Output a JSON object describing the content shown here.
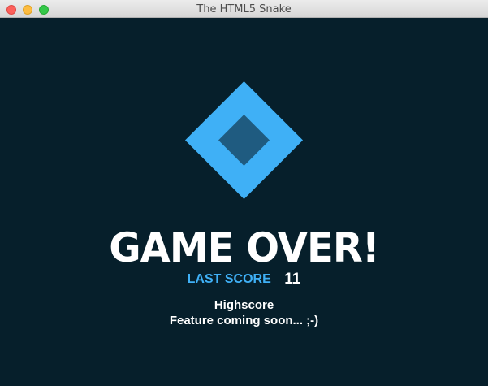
{
  "window": {
    "title": "The HTML5 Snake"
  },
  "game": {
    "headline": "GAME OVER!",
    "last_score_label": "LAST SCORE",
    "last_score_value": "11",
    "highscore_title": "Highscore",
    "highscore_note": "Feature coming soon... ;-)"
  },
  "colors": {
    "background": "#061f2b",
    "accent": "#3fb0f6",
    "logo_inner": "#1f5b80",
    "text": "#ffffff"
  },
  "icons": {
    "logo": "diamond-logo-icon"
  }
}
